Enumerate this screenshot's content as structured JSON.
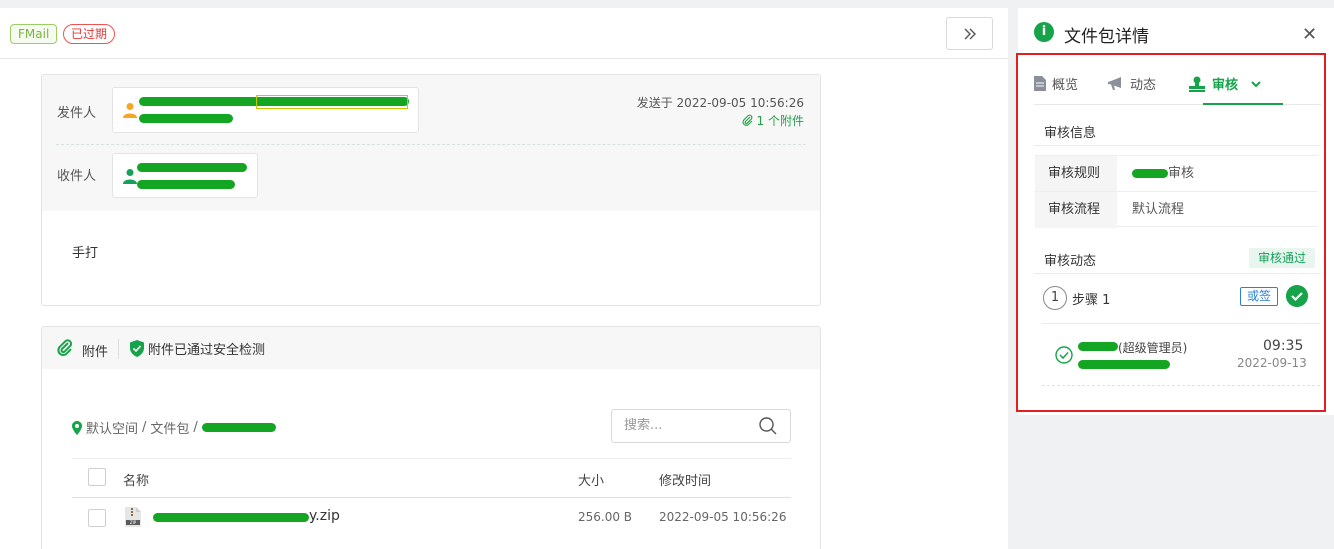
{
  "main": {
    "tags": {
      "fmail": "FMail",
      "expired": "已过期"
    },
    "expand_icon": "double-chevron-right-icon",
    "mail": {
      "sender_label": "发件人",
      "recipient_label": "收件人",
      "sent_at": "发送于 2022-09-05 10:56:26",
      "attachment_count": "1 个附件",
      "body": "手打"
    },
    "attachments": {
      "title": "附件",
      "safe_text": "附件已通过安全检测",
      "path": {
        "root": "默认空间",
        "folder": "文件包",
        "sep": "/"
      },
      "search_placeholder": "搜索...",
      "columns": {
        "name": "名称",
        "size": "大小",
        "modified": "修改时间"
      },
      "rows": [
        {
          "name_suffix": "y.zip",
          "size": "256.00 B",
          "modified": "2022-09-05 10:56:26",
          "icon": "zip-file-icon"
        }
      ]
    },
    "colors": {
      "accent": "#16a34a",
      "redaction": "#14a522",
      "danger": "#e53935",
      "link": "#2f80d1"
    }
  },
  "side": {
    "title": "文件包详情",
    "tabs": [
      {
        "label": "概览",
        "icon": "document-icon"
      },
      {
        "label": "动态",
        "icon": "megaphone-icon"
      },
      {
        "label": "审核",
        "icon": "stamp-icon",
        "active": true
      }
    ],
    "review_info_title": "审核信息",
    "rule_label": "审核规则",
    "rule_value_suffix": "审核",
    "flow_label": "审核流程",
    "flow_value": "默认流程",
    "dynamics_title": "审核动态",
    "status_badge": "审核通过",
    "step": {
      "number": "1",
      "label": "步骤 1",
      "mode": "或签"
    },
    "reviewer": {
      "role": "(超级管理员)",
      "time": "09:35",
      "date": "2022-09-13"
    }
  }
}
